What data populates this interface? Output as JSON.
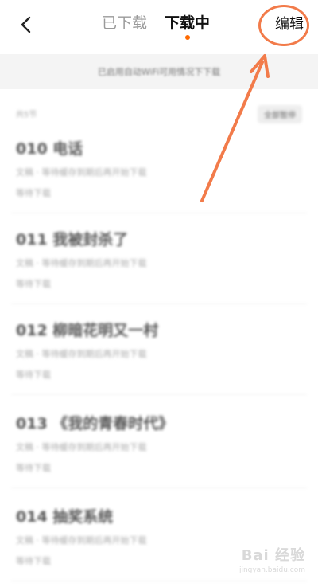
{
  "header": {
    "back_icon": "chevron-left-icon",
    "tabs": [
      {
        "label": "已下载",
        "active": false
      },
      {
        "label": "下载中",
        "active": true
      }
    ],
    "edit_label": "编辑",
    "accent_color": "#ff6a00"
  },
  "notice": {
    "text": "已启用自动WiFi可用情况下下载"
  },
  "list": {
    "section_label": "共5节",
    "all_button": "全部暂停",
    "items": [
      {
        "title": "010 电话",
        "subtitle": "文稿 · 等待缓存到期后再开始下载",
        "status": "等待下载"
      },
      {
        "title": "011 我被封杀了",
        "subtitle": "文稿 · 等待缓存到期后再开始下载",
        "status": "等待下载"
      },
      {
        "title": "012 柳暗花明又一村",
        "subtitle": "文稿 · 等待缓存到期后再开始下载",
        "status": "等待下载"
      },
      {
        "title": "013 《我的青春时代》",
        "subtitle": "文稿 · 等待缓存到期后再开始下载",
        "status": "等待下载"
      },
      {
        "title": "014 抽奖系统",
        "subtitle": "文稿 · 等待缓存到期后再开始下载",
        "status": "等待下载"
      }
    ]
  },
  "annotation": {
    "highlight_color": "#f27b4a"
  },
  "watermark": {
    "text": "Bai 经验",
    "url": "jingyan.baidu.com"
  }
}
